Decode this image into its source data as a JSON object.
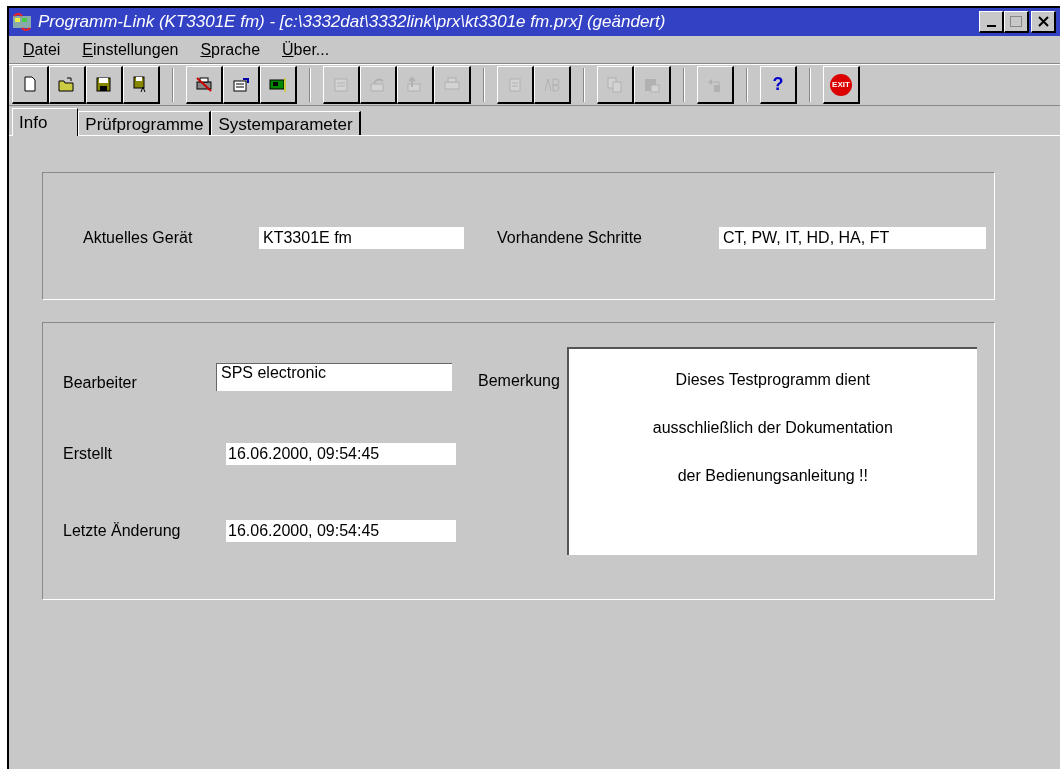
{
  "window": {
    "title": "Programm-Link (KT3301E fm) - [c:\\3332dat\\3332link\\prx\\kt3301e fm.prx] (geändert)"
  },
  "menu": [
    {
      "label": "Datei"
    },
    {
      "label": "Einstellungen"
    },
    {
      "label": "Sprache"
    },
    {
      "label": "Über..."
    }
  ],
  "toolbar": [
    [
      {
        "disabled": false
      },
      {
        "disabled": false
      },
      {
        "disabled": false
      },
      {
        "disabled": false
      }
    ],
    [
      {
        "disabled": false
      },
      {
        "disabled": false
      },
      {
        "disabled": false
      }
    ],
    [
      {
        "disabled": true
      },
      {
        "disabled": true
      },
      {
        "disabled": true
      },
      {
        "disabled": true
      }
    ],
    [
      {
        "disabled": true
      },
      {
        "disabled": true
      }
    ],
    [
      {
        "disabled": true
      },
      {
        "disabled": true
      }
    ],
    [
      {
        "disabled": true
      }
    ],
    [
      {
        "disabled": false,
        "label": "?"
      }
    ],
    [
      {
        "disabled": false,
        "label": "EXIT"
      }
    ]
  ],
  "tabs": [
    {
      "label": "Info",
      "selected": true
    },
    {
      "label": "Prüfprogramme",
      "selected": false
    },
    {
      "label": "Systemparameter",
      "selected": false
    }
  ],
  "device": {
    "label": "Aktuelles Gerät",
    "value": "KT3301E fm",
    "steps_label": "Vorhandene Schritte",
    "steps": "CT, PW, IT, HD, HA, FT"
  },
  "details": {
    "editor_label": "Bearbeiter",
    "editor": "SPS electronic",
    "created_label": "Erstellt",
    "created": "16.06.2000, 09:54:45",
    "modified_label": "Letzte Änderung",
    "modified": "16.06.2000, 09:54:45",
    "remark_label": "Bemerkung",
    "remark": [
      "Dieses Testprogramm dient",
      "ausschließlich der Dokumentation",
      "der Bedienungsanleitung !!"
    ]
  }
}
